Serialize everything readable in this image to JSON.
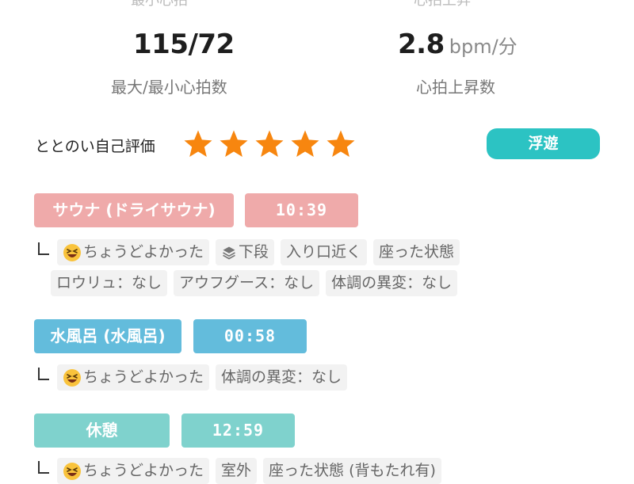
{
  "top_cut": {
    "left": "最小心拍",
    "right": "心拍上昇"
  },
  "stats": {
    "heart_rate": {
      "value": "115/72",
      "label": "最大/最小心拍数"
    },
    "rise": {
      "value": "2.8",
      "unit": "bpm/分",
      "label": "心拍上昇数"
    }
  },
  "evaluation": {
    "label": "ととのい自己評価",
    "rating": 5,
    "max": 5,
    "badge": "浮遊",
    "star_color": "#f7860f",
    "badge_color": "#2cc3c3"
  },
  "sections": {
    "sauna": {
      "name": "サウナ (ドライサウナ)",
      "time": "10:39",
      "color": "#efaaaa",
      "chips": {
        "feeling": "ちょうどよかった",
        "position": "下段",
        "location": "入り口近く",
        "posture": "座った状態",
        "loyly": "ロウリュ：なし",
        "aufguss": "アウフグース：なし",
        "condition": "体調の異変：なし"
      }
    },
    "water": {
      "name": "水風呂 (水風呂)",
      "time": "00:58",
      "color": "#63bcdc",
      "chips": {
        "feeling": "ちょうどよかった",
        "condition": "体調の異変：なし"
      }
    },
    "rest": {
      "name": "休憩",
      "time": "12:59",
      "color": "#7fd2cd",
      "chips": {
        "feeling": "ちょうどよかった",
        "location": "室外",
        "posture": "座った状態 (背もたれ有)"
      }
    }
  }
}
